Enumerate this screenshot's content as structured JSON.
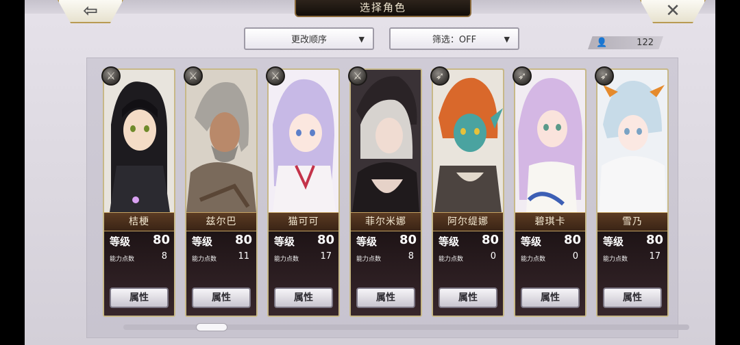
{
  "header": {
    "title": "选择角色",
    "back_icon": "arrow-left-icon",
    "back_glyph": "⇦",
    "close_icon": "close-icon",
    "close_glyph": "✕"
  },
  "toolbar": {
    "sort_label": "更改顺序",
    "filter_label": "筛选：OFF",
    "caret_glyph": "▼",
    "person_glyph": "👤",
    "character_count": "122"
  },
  "characters": [
    {
      "name": "桔梗",
      "level_label": "等级",
      "level": "80",
      "points_label": "能力点数",
      "points": "8",
      "button": "属性",
      "class_icon": "sword-icon",
      "class_glyph": "⚔"
    },
    {
      "name": "兹尔巴",
      "level_label": "等级",
      "level": "80",
      "points_label": "能力点数",
      "points": "11",
      "button": "属性",
      "class_icon": "sword-icon",
      "class_glyph": "⚔"
    },
    {
      "name": "猫可可",
      "level_label": "等级",
      "level": "80",
      "points_label": "能力点数",
      "points": "17",
      "button": "属性",
      "class_icon": "sword-icon",
      "class_glyph": "⚔"
    },
    {
      "name": "菲尔米娜",
      "level_label": "等级",
      "level": "80",
      "points_label": "能力点数",
      "points": "8",
      "button": "属性",
      "class_icon": "sword-icon",
      "class_glyph": "⚔"
    },
    {
      "name": "阿尔缇娜",
      "level_label": "等级",
      "level": "80",
      "points_label": "能力点数",
      "points": "0",
      "button": "属性",
      "class_icon": "bow-icon",
      "class_glyph": "➶"
    },
    {
      "name": "碧琪卡",
      "level_label": "等级",
      "level": "80",
      "points_label": "能力点数",
      "points": "0",
      "button": "属性",
      "class_icon": "bow-icon",
      "class_glyph": "➶"
    },
    {
      "name": "雪乃",
      "level_label": "等级",
      "level": "80",
      "points_label": "能力点数",
      "points": "17",
      "button": "属性",
      "class_icon": "bow-icon",
      "class_glyph": "➶"
    }
  ],
  "colors": {
    "card_border": "#c7b887",
    "name_bar": "#4a2f1c",
    "panel": "#cbc7d2"
  }
}
